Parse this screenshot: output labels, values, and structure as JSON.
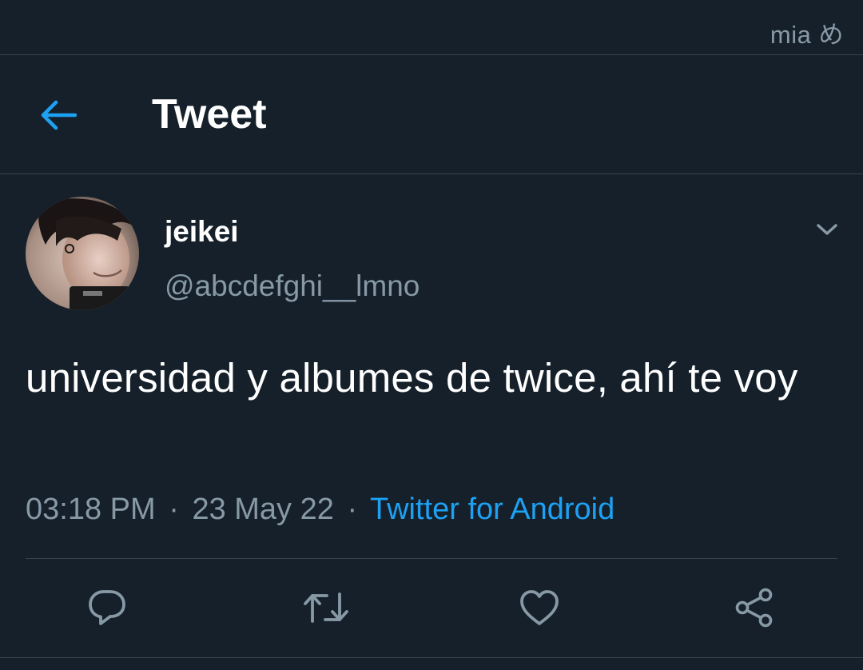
{
  "status_bar": {
    "text": "mia め"
  },
  "header": {
    "title": "Tweet",
    "back_icon": "arrow-left-icon",
    "accent_color": "#1da1f2"
  },
  "tweet": {
    "author": {
      "display_name": "jeikei",
      "handle": "@abcdefghi__lmno"
    },
    "text": "universidad y albumes de twice, ahí te voy",
    "time": "03:18 PM",
    "date": "23 May 22",
    "separator": "·",
    "source": "Twitter for Android"
  },
  "actions": [
    {
      "name": "reply",
      "icon": "reply-icon"
    },
    {
      "name": "retweet",
      "icon": "retweet-icon"
    },
    {
      "name": "like",
      "icon": "heart-icon"
    },
    {
      "name": "share",
      "icon": "share-icon"
    }
  ],
  "colors": {
    "background": "#15202b",
    "border": "#38444d",
    "secondary_text": "#8899a6",
    "link": "#1da1f2"
  }
}
